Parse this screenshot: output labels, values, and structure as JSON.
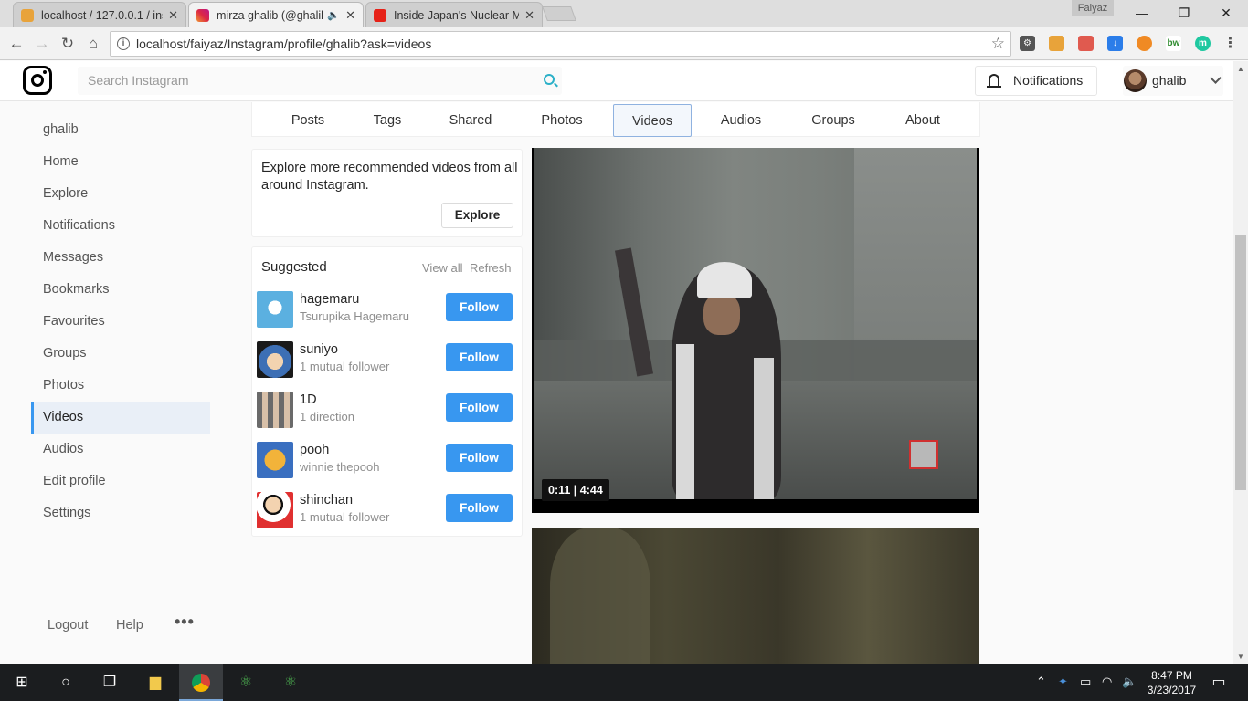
{
  "browser": {
    "tabs": [
      {
        "title": "localhost / 127.0.0.1 / ins",
        "favicon_color": "#e8a33a"
      },
      {
        "title": "mirza ghalib (@ghalib",
        "favicon_color": "#c13584"
      },
      {
        "title": "Inside Japan's Nuclear M",
        "favicon_color": "#e62117"
      }
    ],
    "window_user": "Faiyaz",
    "url": "localhost/faiyaz/Instagram/profile/ghalib?ask=videos"
  },
  "header": {
    "search_placeholder": "Search Instagram",
    "notifications_label": "Notifications",
    "username": "ghalib"
  },
  "sidebar": {
    "items": [
      {
        "label": "ghalib"
      },
      {
        "label": "Home"
      },
      {
        "label": "Explore"
      },
      {
        "label": "Notifications"
      },
      {
        "label": "Messages"
      },
      {
        "label": "Bookmarks"
      },
      {
        "label": "Favourites"
      },
      {
        "label": "Groups"
      },
      {
        "label": "Photos"
      },
      {
        "label": "Videos"
      },
      {
        "label": "Audios"
      },
      {
        "label": "Edit profile"
      },
      {
        "label": "Settings"
      }
    ],
    "active_item": "Videos",
    "footer": {
      "logout": "Logout",
      "help": "Help",
      "more": "•••"
    }
  },
  "profile_tabs": [
    "Posts",
    "Tags",
    "Shared",
    "Photos",
    "Videos",
    "Audios",
    "Groups",
    "About"
  ],
  "active_tab": "Videos",
  "explore_card": {
    "text": "Explore more recommended videos from all around Instagram.",
    "button": "Explore"
  },
  "suggested": {
    "title": "Suggested",
    "view_all": "View all",
    "refresh": "Refresh",
    "follow_label": "Follow",
    "users": [
      {
        "name": "hagemaru",
        "sub": "Tsurupika Hagemaru",
        "avatar_color": "#5bb0e0"
      },
      {
        "name": "suniyo",
        "sub": "1 mutual follower",
        "avatar_color": "#3d6fb5"
      },
      {
        "name": "1D",
        "sub": "1 direction",
        "avatar_color": "#bfbfbf"
      },
      {
        "name": "pooh",
        "sub": "winnie thepooh",
        "avatar_color": "#e8a030"
      },
      {
        "name": "shinchan",
        "sub": "1 mutual follower",
        "avatar_color": "#f0f0f0"
      }
    ]
  },
  "video": {
    "timecode": "0:11 | 4:44"
  },
  "taskbar": {
    "time": "8:47 PM",
    "date": "3/23/2017"
  }
}
